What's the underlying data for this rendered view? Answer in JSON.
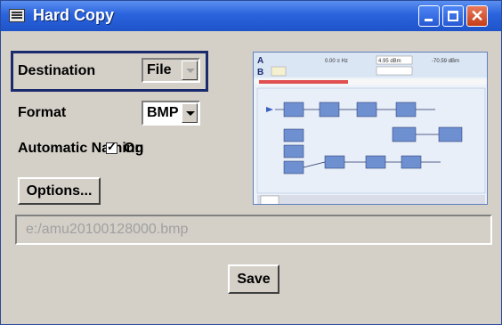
{
  "window": {
    "title": "Hard Copy"
  },
  "destination": {
    "label": "Destination",
    "value": "File"
  },
  "format": {
    "label": "Format",
    "value": "BMP"
  },
  "automatic_naming": {
    "label": "Automatic Naming",
    "checked": true,
    "state_label": "On"
  },
  "options_button": {
    "label": "Options..."
  },
  "file_path": {
    "value": "e:/amu20100128000.bmp"
  },
  "save_button": {
    "label": "Save"
  },
  "preview": {
    "header_a": "A",
    "header_b": "B",
    "freq": "0.00 ≡ Hz",
    "level": "4.95 dBm",
    "level2": "-70.59 dBm"
  }
}
